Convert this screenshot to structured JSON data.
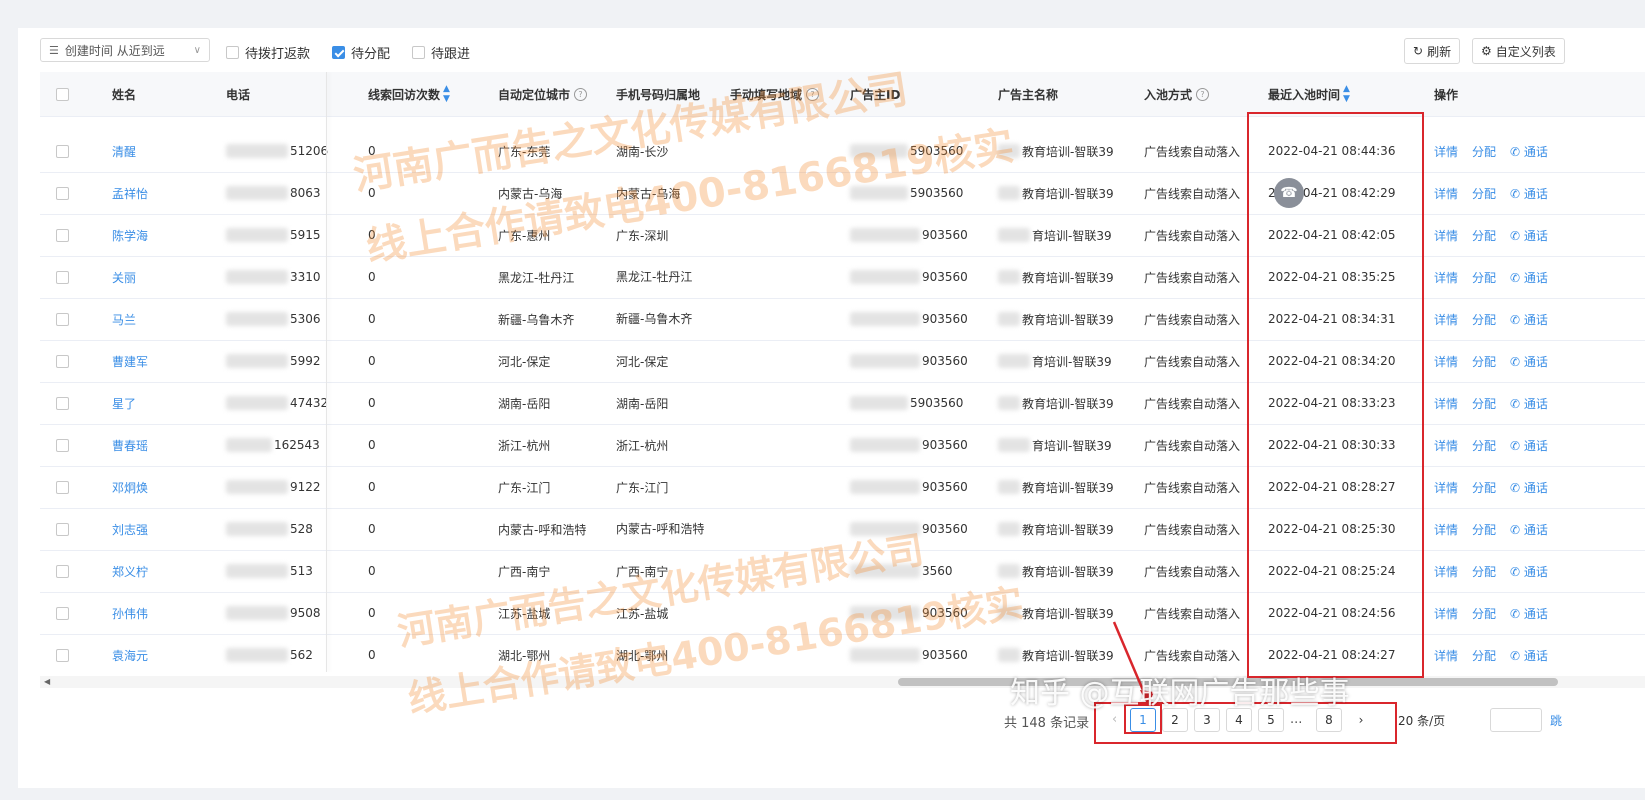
{
  "toolbar": {
    "sort_select": "创建时间 从近到远",
    "filters": [
      {
        "label": "待拨打返款",
        "checked": false
      },
      {
        "label": "待分配",
        "checked": true
      },
      {
        "label": "待跟进",
        "checked": false
      }
    ],
    "refresh_label": "刷新",
    "customize_label": "自定义列表"
  },
  "columns": {
    "name": "姓名",
    "phone": "电话",
    "visits": "线索回访次数",
    "auto_city": "自动定位城市",
    "phone_region": "手机号码归属地",
    "manual_region": "手动填写地域",
    "advertiser_id": "广告主ID",
    "advertiser_name": "广告主名称",
    "entry_method": "入池方式",
    "recent_time": "最近入池时间",
    "actions": "操作"
  },
  "actions": {
    "detail": "详情",
    "assign": "分配",
    "call": "通话"
  },
  "rows": [
    {
      "name": "清醒",
      "phone": "51206",
      "visits": "0",
      "auto_city": "广东-东莞",
      "phone_region": "湖南-长沙",
      "advertiser_id": "5903560",
      "advertiser_name": "教育培训-智联39",
      "entry_method": "广告线索自动落入",
      "recent_time": "2022-04-21 08:44:36"
    },
    {
      "name": "孟祥怡",
      "phone": "8063",
      "visits": "0",
      "auto_city": "内蒙古-乌海",
      "phone_region": "内蒙古-乌海",
      "advertiser_id": "5903560",
      "advertiser_name": "教育培训-智联39",
      "entry_method": "广告线索自动落入",
      "recent_time": "2022-04-21 08:42:29"
    },
    {
      "name": "陈学海",
      "phone": "5915",
      "visits": "0",
      "auto_city": "广东-惠州",
      "phone_region": "广东-深圳",
      "advertiser_id": "903560",
      "advertiser_name": "育培训-智联39",
      "entry_method": "广告线索自动落入",
      "recent_time": "2022-04-21 08:42:05"
    },
    {
      "name": "关丽",
      "phone": "3310",
      "visits": "0",
      "auto_city": "黑龙江-牡丹江",
      "phone_region": "黑龙江-牡丹江",
      "advertiser_id": "903560",
      "advertiser_name": "教育培训-智联39",
      "entry_method": "广告线索自动落入",
      "recent_time": "2022-04-21 08:35:25"
    },
    {
      "name": "马兰",
      "phone": "5306",
      "visits": "0",
      "auto_city": "新疆-乌鲁木齐",
      "phone_region": "新疆-乌鲁木齐",
      "advertiser_id": "903560",
      "advertiser_name": "教育培训-智联39",
      "entry_method": "广告线索自动落入",
      "recent_time": "2022-04-21 08:34:31"
    },
    {
      "name": "曹建军",
      "phone": "5992",
      "visits": "0",
      "auto_city": "河北-保定",
      "phone_region": "河北-保定",
      "advertiser_id": "903560",
      "advertiser_name": "育培训-智联39",
      "entry_method": "广告线索自动落入",
      "recent_time": "2022-04-21 08:34:20"
    },
    {
      "name": "星了",
      "phone": "47432",
      "visits": "0",
      "auto_city": "湖南-岳阳",
      "phone_region": "湖南-岳阳",
      "advertiser_id": "5903560",
      "advertiser_name": "教育培训-智联39",
      "entry_method": "广告线索自动落入",
      "recent_time": "2022-04-21 08:33:23"
    },
    {
      "name": "曹春瑶",
      "phone": "162543",
      "visits": "0",
      "auto_city": "浙江-杭州",
      "phone_region": "浙江-杭州",
      "advertiser_id": "903560",
      "advertiser_name": "育培训-智联39",
      "entry_method": "广告线索自动落入",
      "recent_time": "2022-04-21 08:30:33"
    },
    {
      "name": "邓炯焕",
      "phone": "9122",
      "visits": "0",
      "auto_city": "广东-江门",
      "phone_region": "广东-江门",
      "advertiser_id": "903560",
      "advertiser_name": "教育培训-智联39",
      "entry_method": "广告线索自动落入",
      "recent_time": "2022-04-21 08:28:27"
    },
    {
      "name": "刘志强",
      "phone": "528",
      "visits": "0",
      "auto_city": "内蒙古-呼和浩特",
      "phone_region": "内蒙古-呼和浩特",
      "advertiser_id": "903560",
      "advertiser_name": "教育培训-智联39",
      "entry_method": "广告线索自动落入",
      "recent_time": "2022-04-21 08:25:30"
    },
    {
      "name": "郑义柠",
      "phone": "513",
      "visits": "0",
      "auto_city": "广西-南宁",
      "phone_region": "广西-南宁",
      "advertiser_id": "3560",
      "advertiser_name": "教育培训-智联39",
      "entry_method": "广告线索自动落入",
      "recent_time": "2022-04-21 08:25:24"
    },
    {
      "name": "孙伟伟",
      "phone": "9508",
      "visits": "0",
      "auto_city": "江苏-盐城",
      "phone_region": "江苏-盐城",
      "advertiser_id": "903560",
      "advertiser_name": "教育培训-智联39",
      "entry_method": "广告线索自动落入",
      "recent_time": "2022-04-21 08:24:56"
    },
    {
      "name": "袁海元",
      "phone": "562",
      "visits": "0",
      "auto_city": "湖北-鄂州",
      "phone_region": "湖北-鄂州",
      "advertiser_id": "903560",
      "advertiser_name": "教育培训-智联39",
      "entry_method": "广告线索自动落入",
      "recent_time": "2022-04-21 08:24:27"
    }
  ],
  "pagination": {
    "total_text": "共 148 条记录",
    "pages": [
      "1",
      "2",
      "3",
      "4",
      "5"
    ],
    "ellipsis": "...",
    "last_page": "8",
    "current": "1",
    "page_size": "20 条/页",
    "jump_label": "跳"
  },
  "watermark": {
    "line1": "河南广而告之文化传媒有限公司",
    "line2": "线上合作请致电400-8166819核实",
    "zhihu": "知乎 @互联网广告那些事"
  }
}
